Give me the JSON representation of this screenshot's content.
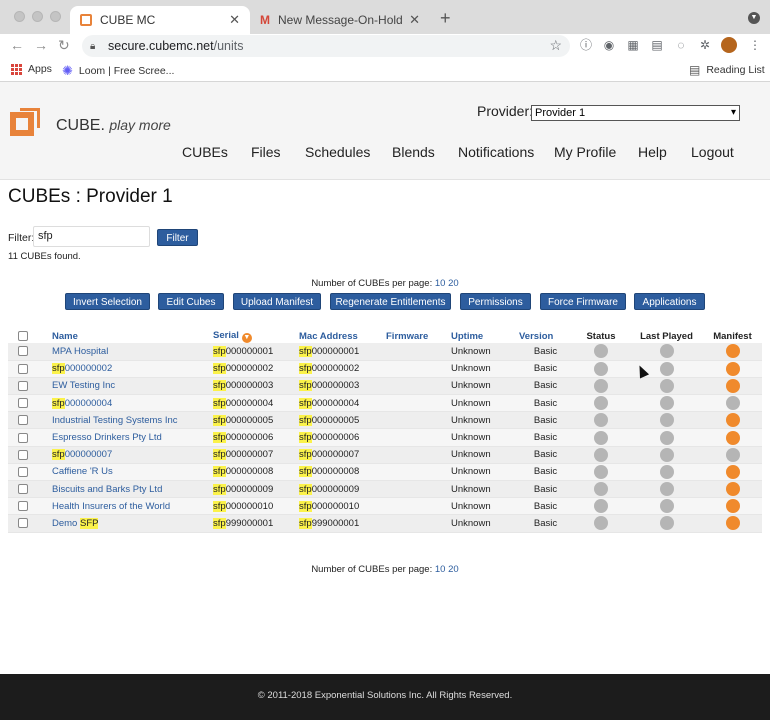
{
  "browser": {
    "tabs": [
      {
        "title": "CUBE MC",
        "active": true
      },
      {
        "title": "New Message-On-Hold for Der",
        "active": false
      }
    ],
    "new_tab": "+",
    "close_glyph": "✕",
    "url_host": "secure.cubemc.net",
    "url_path": "/units",
    "bookmarks": [
      {
        "label": "Apps",
        "icon": "apps-icon"
      },
      {
        "label": "Loom | Free Scree...",
        "icon": "loom-icon"
      }
    ],
    "reading_list": "Reading List"
  },
  "header": {
    "logo_text": "CUBE.",
    "logo_tagline": "play more",
    "provider_label": "Provider:",
    "provider_selected": "Provider 1",
    "nav": [
      "CUBEs",
      "Files",
      "Schedules",
      "Blends",
      "Notifications",
      "My Profile",
      "Help",
      "Logout"
    ]
  },
  "page": {
    "title": "CUBEs : Provider 1",
    "filter_label": "Filter:",
    "filter_value": "sfp",
    "filter_button": "Filter",
    "found_text": "11 CUBEs found.",
    "per_page_label": "Number of CUBEs per page:",
    "per_page_options": [
      "10",
      "20"
    ],
    "actions": [
      "Invert Selection",
      "Edit Cubes",
      "Upload Manifest",
      "Regenerate Entitlements",
      "Permissions",
      "Force Firmware",
      "Applications"
    ]
  },
  "table": {
    "columns": [
      "Name",
      "Serial",
      "Mac Address",
      "Firmware",
      "Uptime",
      "Version",
      "Status",
      "Last Played",
      "Manifest"
    ],
    "rows": [
      {
        "name_pre": "MPA Hospital",
        "name_hl": "",
        "name_post": "",
        "serial": "000000001",
        "mac": "000000001",
        "firmware": "",
        "uptime": "Unknown",
        "version": "Basic",
        "manifest": "orange"
      },
      {
        "name_pre": "",
        "name_hl": "sfp",
        "name_post": "000000002",
        "serial": "000000002",
        "mac": "000000002",
        "firmware": "",
        "uptime": "Unknown",
        "version": "Basic",
        "manifest": "orange"
      },
      {
        "name_pre": "EW Testing Inc",
        "name_hl": "",
        "name_post": "",
        "serial": "000000003",
        "mac": "000000003",
        "firmware": "",
        "uptime": "Unknown",
        "version": "Basic",
        "manifest": "orange"
      },
      {
        "name_pre": "",
        "name_hl": "sfp",
        "name_post": "000000004",
        "serial": "000000004",
        "mac": "000000004",
        "firmware": "",
        "uptime": "Unknown",
        "version": "Basic",
        "manifest": "grey"
      },
      {
        "name_pre": "Industrial Testing Systems Inc",
        "name_hl": "",
        "name_post": "",
        "serial": "000000005",
        "mac": "000000005",
        "firmware": "",
        "uptime": "Unknown",
        "version": "Basic",
        "manifest": "orange"
      },
      {
        "name_pre": "Espresso Drinkers Pty Ltd",
        "name_hl": "",
        "name_post": "",
        "serial": "000000006",
        "mac": "000000006",
        "firmware": "",
        "uptime": "Unknown",
        "version": "Basic",
        "manifest": "orange"
      },
      {
        "name_pre": "",
        "name_hl": "sfp",
        "name_post": "000000007",
        "serial": "000000007",
        "mac": "000000007",
        "firmware": "",
        "uptime": "Unknown",
        "version": "Basic",
        "manifest": "grey"
      },
      {
        "name_pre": "Caffiene 'R Us",
        "name_hl": "",
        "name_post": "",
        "serial": "000000008",
        "mac": "000000008",
        "firmware": "",
        "uptime": "Unknown",
        "version": "Basic",
        "manifest": "orange"
      },
      {
        "name_pre": "Biscuits and Barks Pty Ltd",
        "name_hl": "",
        "name_post": "",
        "serial": "000000009",
        "mac": "000000009",
        "firmware": "",
        "uptime": "Unknown",
        "version": "Basic",
        "manifest": "orange"
      },
      {
        "name_pre": "Health Insurers of the World",
        "name_hl": "",
        "name_post": "",
        "serial": "000000010",
        "mac": "000000010",
        "firmware": "",
        "uptime": "Unknown",
        "version": "Basic",
        "manifest": "orange"
      },
      {
        "name_pre": "Demo ",
        "name_hl": "SFP",
        "name_post": "",
        "serial": "999000001",
        "mac": "999000001",
        "firmware": "",
        "uptime": "Unknown",
        "version": "Basic",
        "manifest": "orange"
      }
    ],
    "highlight_term": "sfp"
  },
  "footer": {
    "text": "© 2011-2018 Exponential Solutions Inc. All Rights Reserved."
  },
  "colors": {
    "accent": "#2d5d9e",
    "brand_orange": "#f08a2c",
    "highlight": "#fbf24a"
  }
}
